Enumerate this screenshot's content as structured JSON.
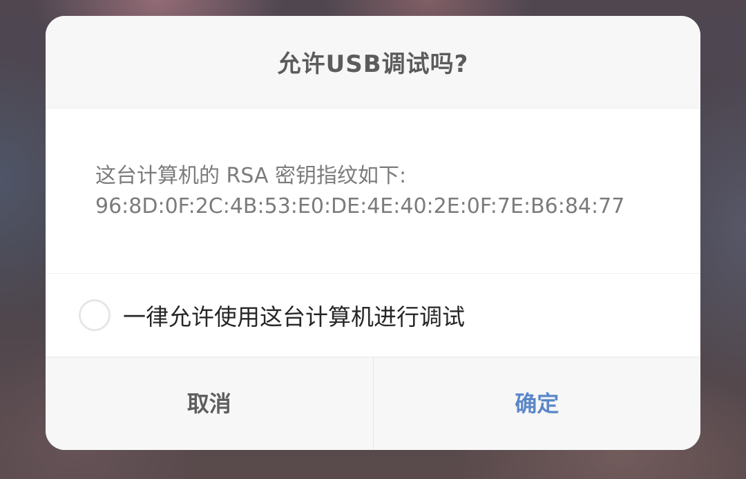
{
  "dialog": {
    "title": "允许USB调试吗?",
    "message": {
      "line1": "这台计算机的 RSA 密钥指纹如下:",
      "fingerprint": "96:8D:0F:2C:4B:53:E0:DE:4E:40:2E:0F:7E:B6:84:77"
    },
    "always_allow": {
      "label": "一律允许使用这台计算机进行调试",
      "checked": false
    },
    "buttons": {
      "cancel": "取消",
      "confirm": "确定"
    },
    "colors": {
      "confirm_accent": "#5b87c9",
      "title_text": "#5c5c5c",
      "message_text": "#7b7b7b"
    }
  }
}
